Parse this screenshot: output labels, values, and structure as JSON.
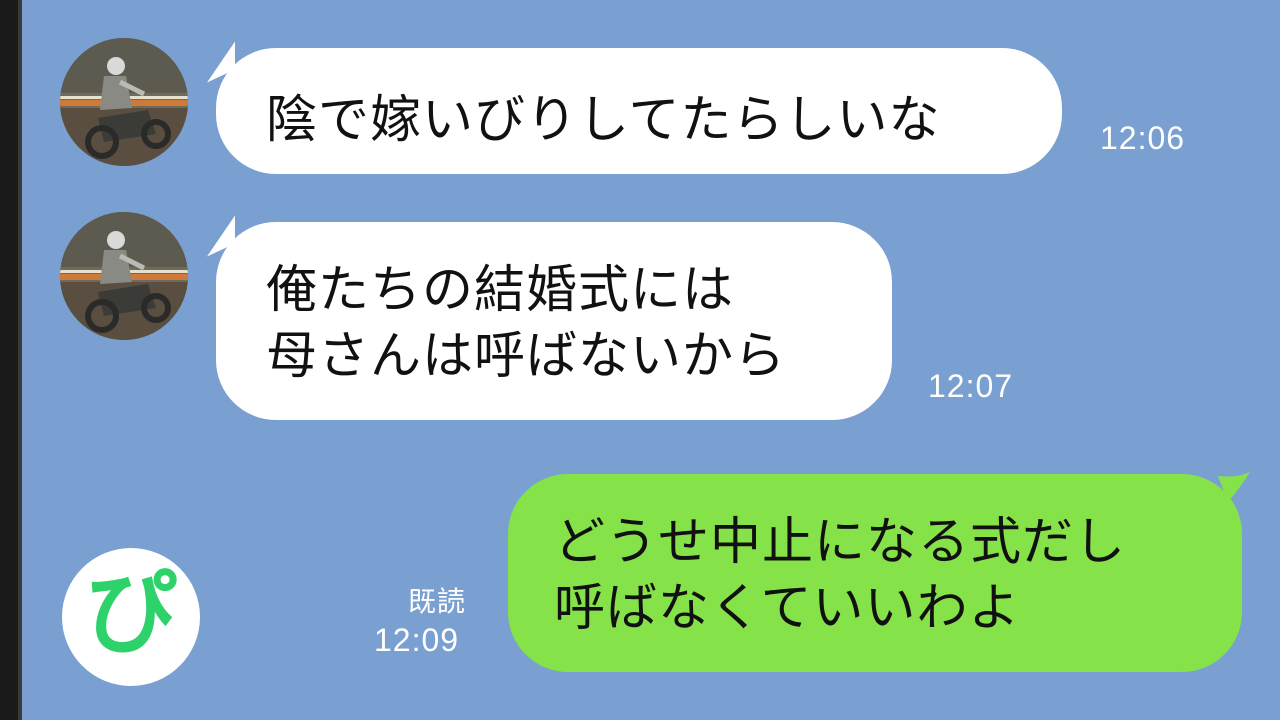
{
  "chat": {
    "background_color": "#7aa0d2",
    "incoming_bubble_color": "#ffffff",
    "outgoing_bubble_color": "#85e249",
    "messages": [
      {
        "direction": "incoming",
        "lines": [
          "陰で嫁いびりしてたらしいな"
        ],
        "time": "12:06",
        "avatar": "motocross-rider-avatar"
      },
      {
        "direction": "incoming",
        "lines": [
          "俺たちの結婚式には",
          "母さんは呼ばないから"
        ],
        "time": "12:07",
        "avatar": "motocross-rider-avatar"
      },
      {
        "direction": "outgoing",
        "lines": [
          "どうせ中止になる式だし",
          "呼ばなくていいわよ"
        ],
        "read_label": "既読",
        "time": "12:09"
      }
    ]
  },
  "logo": {
    "glyph": "ぴ",
    "icon": "pi-logo-icon",
    "color": "#2ed26a"
  }
}
